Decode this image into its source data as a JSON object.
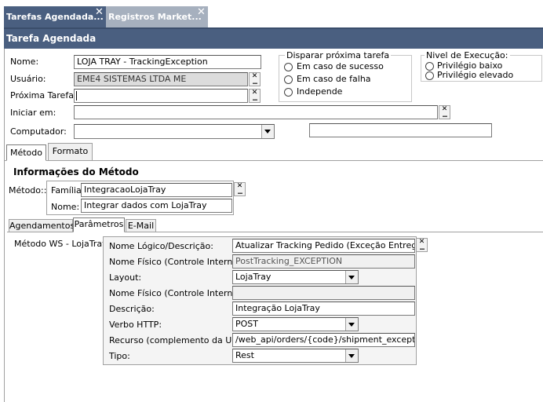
{
  "tabs": [
    {
      "label": "Tarefas Agendada..."
    },
    {
      "label": "Registros Market..."
    }
  ],
  "panel_title": "Tarefa Agendada",
  "form": {
    "nome_label": "Nome:",
    "nome_value": "LOJA TRAY - TrackingException",
    "usuario_label": "Usuário:",
    "usuario_value": "EME4 SISTEMAS LTDA ME",
    "proxima_label": "Próxima Tarefa:",
    "proxima_value": "",
    "iniciar_label": "Iniciar em:",
    "iniciar_value": "",
    "computador_label": "Computador:",
    "computador_value": "",
    "computador_extra": ""
  },
  "disparar": {
    "title": "Disparar próxima tarefa",
    "options": [
      "Em caso de sucesso",
      "Em caso de falha",
      "Independe"
    ]
  },
  "nivel": {
    "title": "Nivel de Execução:",
    "options": [
      "Privilégio baixo",
      "Privilégio elevado"
    ]
  },
  "main_tabs": [
    {
      "label": "Método"
    },
    {
      "label": "Formato"
    }
  ],
  "metodo": {
    "section_title": "Informações do Método",
    "label": "Método::",
    "familia_label": "Família:",
    "familia_value": "IntegracaoLojaTray",
    "nome_label": "Nome:",
    "nome_value": "Integrar dados com LojaTray"
  },
  "sub_tabs": [
    {
      "label": "Agendamentos"
    },
    {
      "label": "Parâmetros"
    },
    {
      "label": "E-Mail"
    }
  ],
  "params": {
    "ws_label": "Método WS - LojaTray",
    "rows": [
      {
        "label": "Nome Lógico/Descrição:",
        "value": "Atualizar Tracking Pedido (Exceção Entrega) LojaTray"
      },
      {
        "label": "Nome Físico (Controle Interno):",
        "value": "PostTracking_EXCEPTION"
      },
      {
        "label": "Layout:",
        "value": "LojaTray"
      },
      {
        "label": "Nome Físico (Controle Interno):",
        "value": ""
      },
      {
        "label": "Descrição:",
        "value": "Integração LojaTray"
      },
      {
        "label": "Verbo HTTP:",
        "value": "POST"
      },
      {
        "label": "Recurso (complemento da URL):",
        "value": "/web_api/orders/{code}/shipment_exception"
      },
      {
        "label": "Tipo:",
        "value": "Rest"
      }
    ]
  }
}
